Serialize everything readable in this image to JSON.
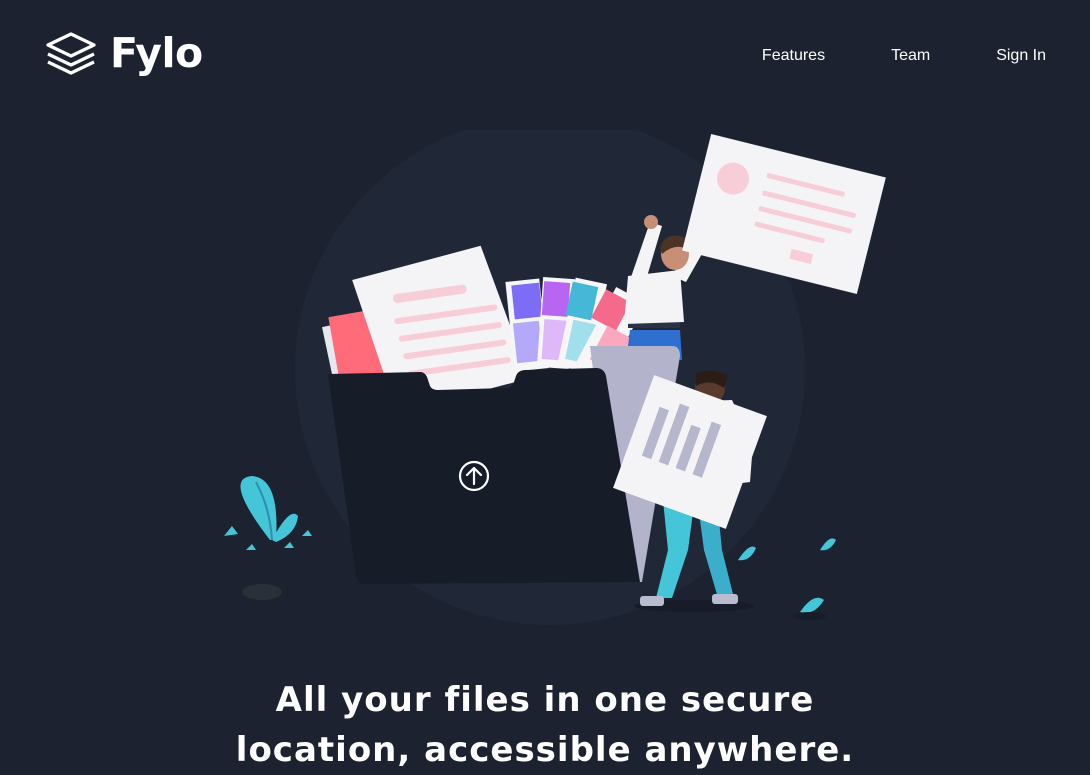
{
  "brand": {
    "name": "Fylo",
    "logo_icon": "stacked-layers-icon"
  },
  "nav": {
    "items": [
      {
        "label": "Features"
      },
      {
        "label": "Team"
      },
      {
        "label": "Sign In"
      }
    ]
  },
  "hero": {
    "illustration": "files-folder-illustration",
    "headline_line1": "All your files in one secure",
    "headline_line2": "location, accessible anywhere."
  },
  "colors": {
    "background": "#1c2230",
    "folder": "#161c28",
    "accent_cyan": "#45c5d8",
    "accent_pink": "#f0a3b8",
    "text": "#ffffff"
  }
}
